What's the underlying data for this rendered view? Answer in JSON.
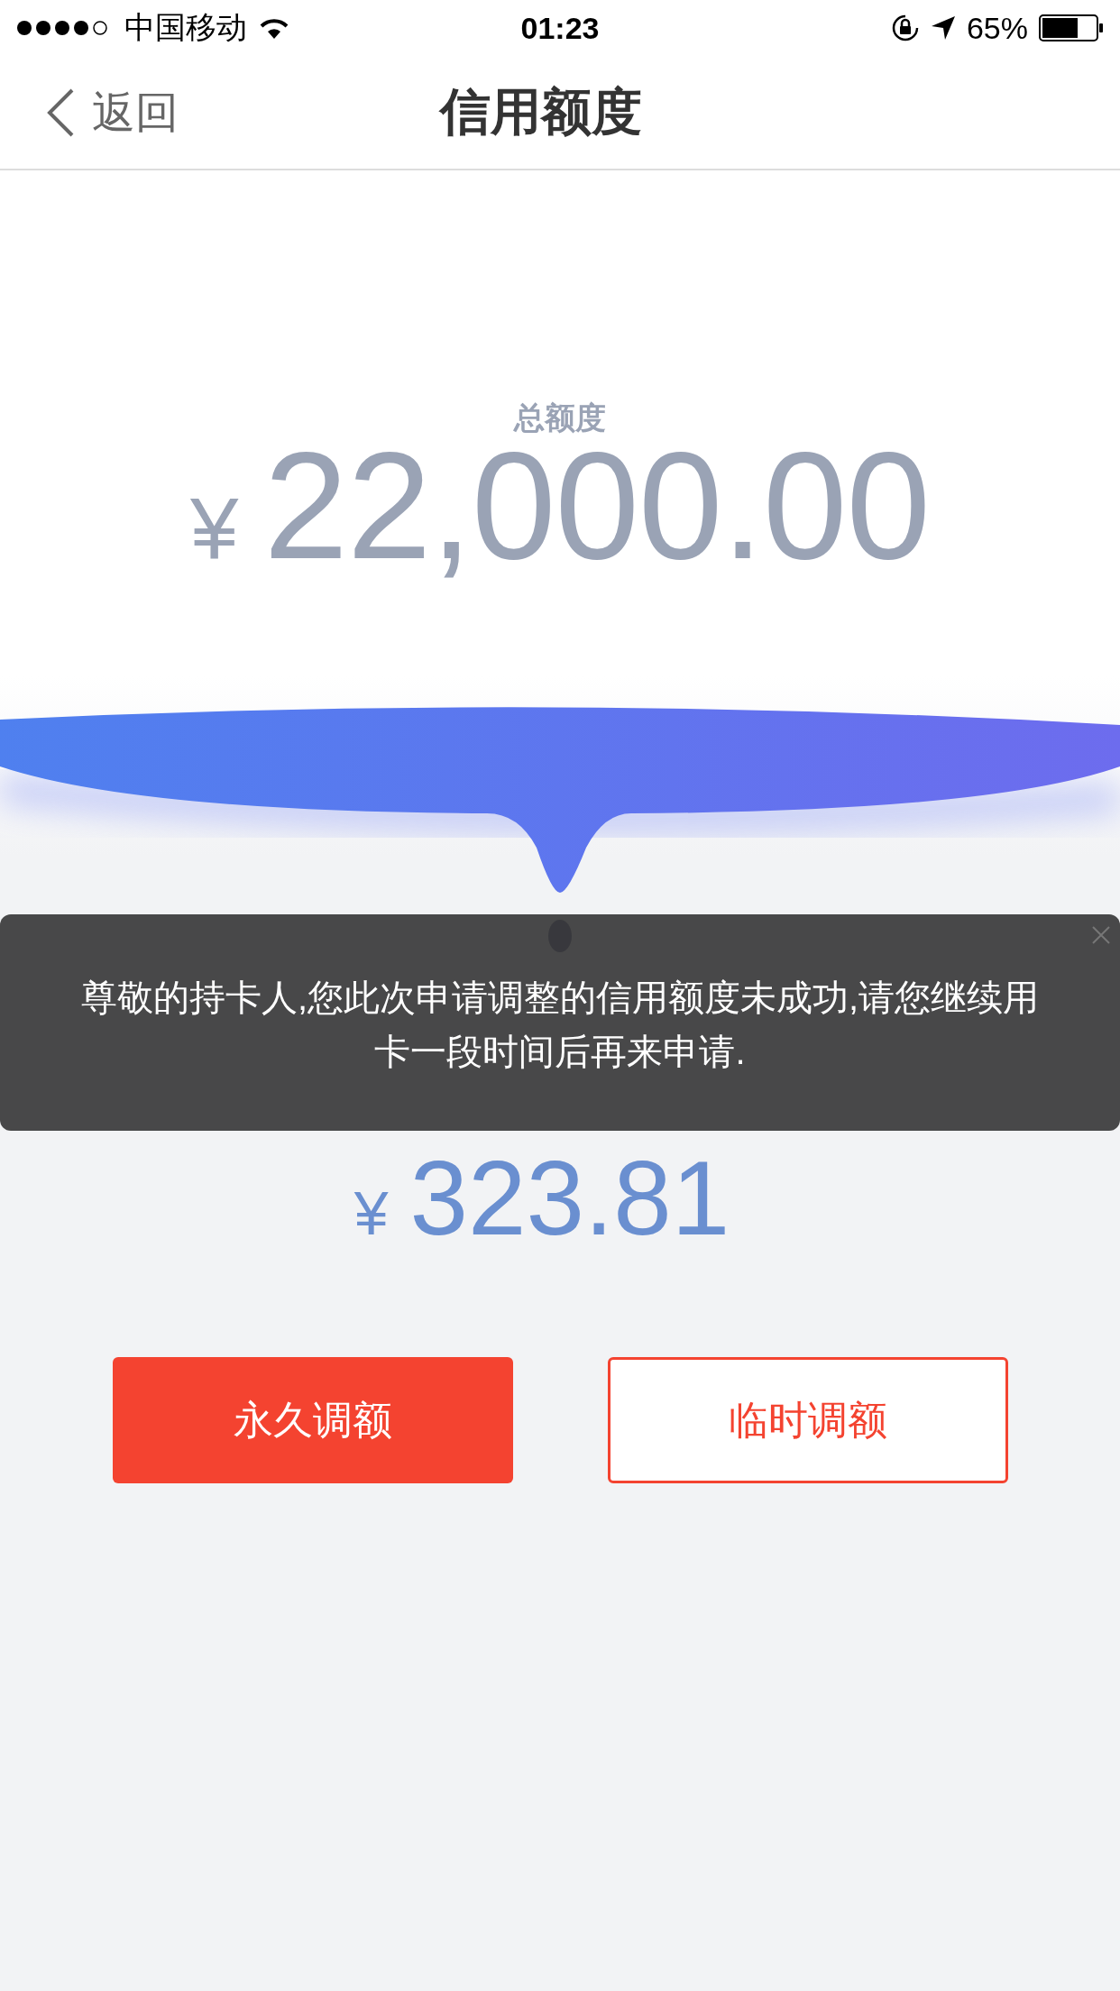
{
  "status_bar": {
    "carrier": "中国移动",
    "time": "01:23",
    "battery_percent": "65%"
  },
  "nav": {
    "back": "返回",
    "title": "信用额度"
  },
  "total": {
    "label": "总额度",
    "currency": "¥",
    "amount": "22,000.00"
  },
  "toast": {
    "message": "尊敬的持卡人,您此次申请调整的信用额度未成功,请您继续用卡一段时间后再来申请."
  },
  "available": {
    "currency": "¥",
    "amount": "323.81"
  },
  "buttons": [
    {
      "label": "永久调额",
      "kind": "primary"
    },
    {
      "label": "临时调额",
      "kind": "outline"
    }
  ]
}
